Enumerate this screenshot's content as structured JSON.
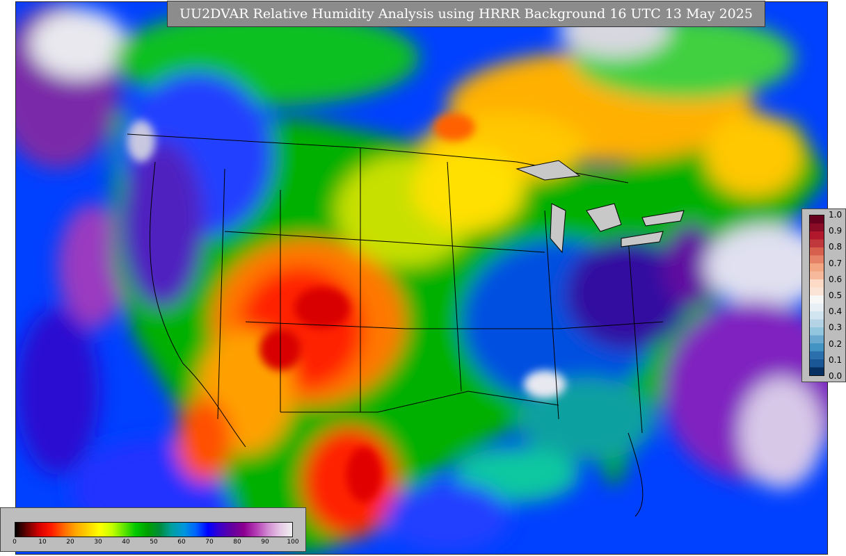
{
  "title": "UU2DVAR Relative Humidity Analysis using HRRR Background 16 UTC 13 May 2025",
  "rh_colorbar": {
    "ticks": [
      "0",
      "10",
      "20",
      "30",
      "40",
      "50",
      "60",
      "70",
      "80",
      "90",
      "100"
    ],
    "colors": [
      "#000000",
      "#6b0000",
      "#d80000",
      "#ff1a00",
      "#ff6600",
      "#ffa500",
      "#ffd200",
      "#ffff00",
      "#c8ff00",
      "#64e600",
      "#00c800",
      "#00a000",
      "#008c3c",
      "#00a0a0",
      "#0096dc",
      "#0064ff",
      "#0000ff",
      "#3c00c8",
      "#6400a0",
      "#8c0090",
      "#b43cb4",
      "#d28cd2",
      "#e6c8e6",
      "#f0f0f0"
    ]
  },
  "increment_colorbar": {
    "ticks": [
      "0.0",
      "0.1",
      "0.2",
      "0.3",
      "0.4",
      "0.5",
      "0.6",
      "0.7",
      "0.8",
      "0.9",
      "1.0"
    ],
    "colors": [
      "#053061",
      "#1a5796",
      "#2b6fad",
      "#4393c3",
      "#6ba8cf",
      "#92c5de",
      "#b4d4e6",
      "#d1e5f0",
      "#e9f0f5",
      "#f7f7f7",
      "#fbe4d6",
      "#fddbc7",
      "#f6b99c",
      "#f4a582",
      "#e58267",
      "#d6604d",
      "#c0383b",
      "#b2182b",
      "#8a0b25",
      "#67001f"
    ]
  },
  "colors": {
    "ocean": "#0050ff",
    "ocean_deep": "#6a00b0",
    "dry": "#ff2a00",
    "moist": "#00c000",
    "title_bg": "#8c8c8c",
    "legend_bg": "#bdbdbd"
  }
}
